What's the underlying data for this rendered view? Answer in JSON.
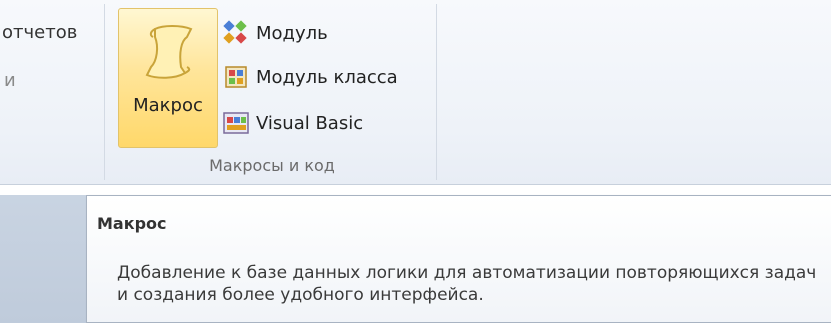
{
  "ribbon": {
    "prev_group": {
      "label_top": "отчетов",
      "label_bottom": "и"
    },
    "macros_group": {
      "caption": "Макросы и код",
      "macro_button": {
        "label": "Макрос",
        "icon": "macro-scroll-icon"
      },
      "items": [
        {
          "label": "Модуль",
          "icon": "module-icon"
        },
        {
          "label": "Модуль класса",
          "icon": "class-module-icon"
        },
        {
          "label": "Visual Basic",
          "icon": "visual-basic-icon"
        }
      ]
    }
  },
  "tooltip": {
    "title": "Макрос",
    "body": "Добавление к базе данных логики для автоматизации повторяющихся задач и создания более удобного интерфейса."
  }
}
